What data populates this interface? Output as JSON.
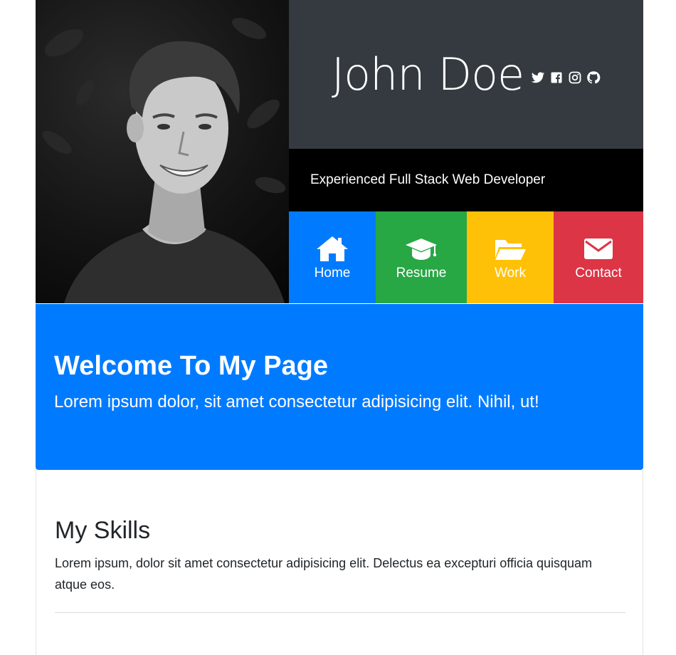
{
  "header": {
    "name": "John Doe",
    "tagline": "Experienced Full Stack Web Developer",
    "social_icons": [
      "twitter-icon",
      "facebook-icon",
      "instagram-icon",
      "github-icon"
    ]
  },
  "nav": [
    {
      "label": "Home",
      "icon": "home-icon",
      "color": "#007bff"
    },
    {
      "label": "Resume",
      "icon": "graduation-cap-icon",
      "color": "#28a745"
    },
    {
      "label": "Work",
      "icon": "folder-open-icon",
      "color": "#ffc107"
    },
    {
      "label": "Contact",
      "icon": "envelope-icon",
      "color": "#dc3545"
    }
  ],
  "jumbotron": {
    "title": "Welcome To My Page",
    "text": "Lorem ipsum dolor, sit amet consectetur adipisicing elit. Nihil, ut!",
    "color": "#007bff"
  },
  "skills": {
    "title": "My Skills",
    "text": "Lorem ipsum, dolor sit amet consectetur adipisicing elit. Delectus ea excepturi officia quisquam atque eos."
  },
  "colors": {
    "name_box": "#343a40",
    "tagline_box": "#000000"
  }
}
